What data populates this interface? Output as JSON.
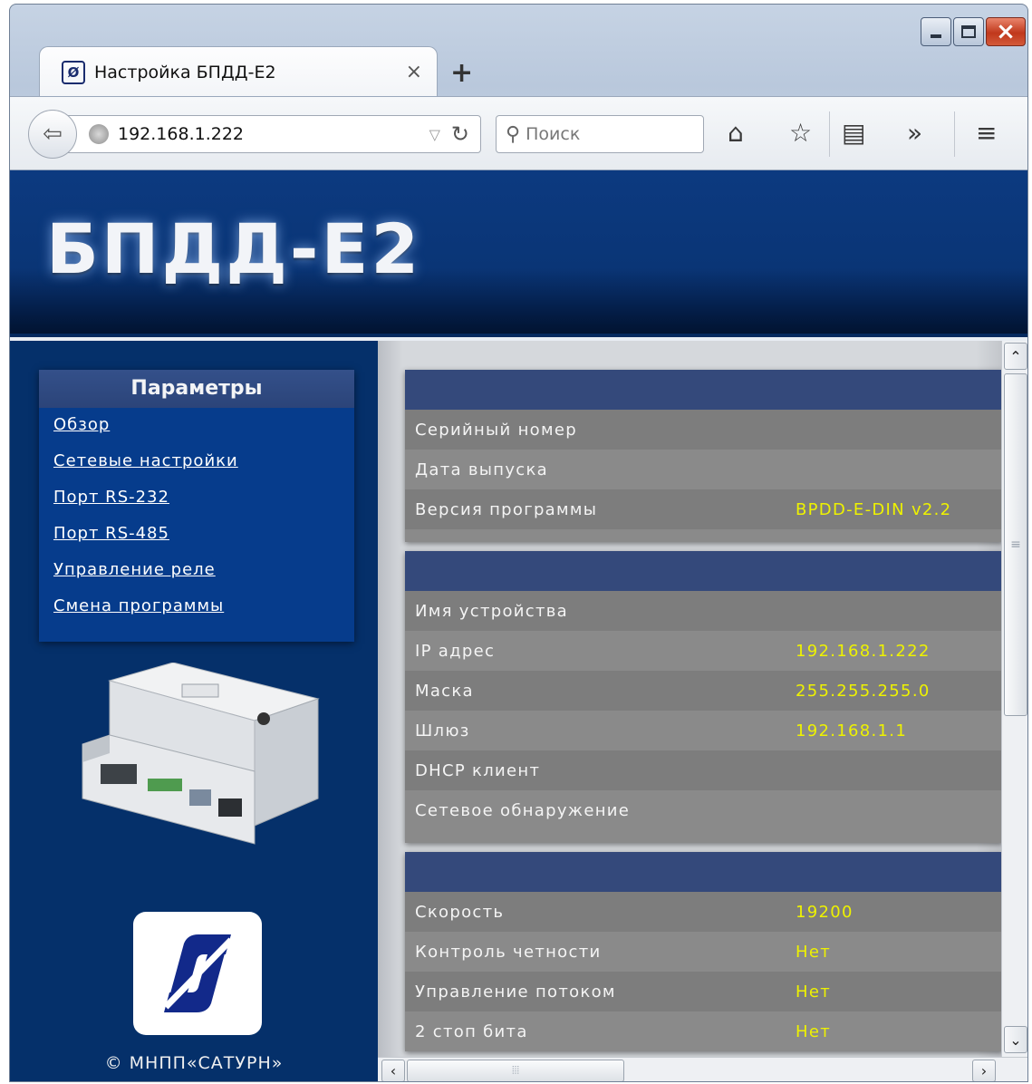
{
  "browser": {
    "tab_title": "Настройка БПДД-E2",
    "tab_favicon": "saturn-logo-icon",
    "tab_close": "×",
    "new_tab": "+",
    "url": "192.168.1.222",
    "search_placeholder": "Поиск"
  },
  "site": {
    "title": "БПДД-Е2",
    "copyright": "© МНПП«САТУРН»"
  },
  "sidebar": {
    "heading": "Параметры",
    "links": [
      {
        "label": "Обзор"
      },
      {
        "label": "Сетевые настройки"
      },
      {
        "label": "Порт RS-232"
      },
      {
        "label": "Порт RS-485"
      },
      {
        "label": "Управление реле"
      },
      {
        "label": "Смена программы"
      }
    ]
  },
  "panels": [
    {
      "rows": [
        {
          "label": "Серийный номер",
          "value": ""
        },
        {
          "label": "Дата выпуска",
          "value": ""
        },
        {
          "label": "Версия программы",
          "value": "BPDD-E-DIN v2.2"
        }
      ]
    },
    {
      "rows": [
        {
          "label": "Имя устройства",
          "value": ""
        },
        {
          "label": "IP адрес",
          "value": "192.168.1.222"
        },
        {
          "label": "Маска",
          "value": "255.255.255.0"
        },
        {
          "label": "Шлюз",
          "value": "192.168.1.1"
        },
        {
          "label": "DHCP клиент",
          "value": ""
        },
        {
          "label": "Сетевое обнаружение",
          "value": ""
        }
      ]
    },
    {
      "rows": [
        {
          "label": "Скорость",
          "value": "19200"
        },
        {
          "label": "Контроль четности",
          "value": "Нет"
        },
        {
          "label": "Управление потоком",
          "value": "Нет"
        },
        {
          "label": "2 стоп бита",
          "value": "Нет"
        }
      ]
    }
  ],
  "colors": {
    "header_blue": "#0a3576",
    "sidebar_blue": "#05306a",
    "panel_header": "#34497b",
    "value_yellow": "#eef200"
  }
}
